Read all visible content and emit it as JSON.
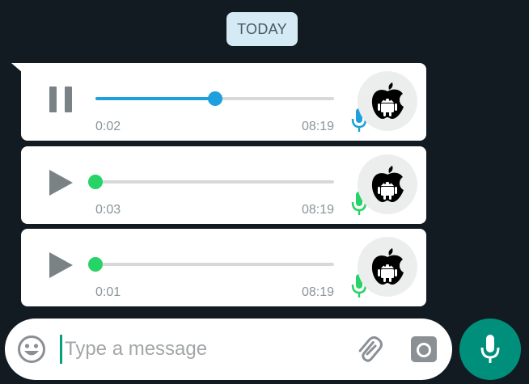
{
  "date_chip": "TODAY",
  "messages": [
    {
      "state": "playing",
      "control_icon": "pause-icon",
      "progress": 0.5,
      "duration": "0:02",
      "time": "08:19",
      "mic_color": "#1ea0dd",
      "knob_color": "#1ea0dd"
    },
    {
      "state": "paused",
      "control_icon": "play-icon",
      "progress": 0.0,
      "duration": "0:03",
      "time": "08:19",
      "mic_color": "#25d366",
      "knob_color": "#25d366"
    },
    {
      "state": "paused",
      "control_icon": "play-icon",
      "progress": 0.0,
      "duration": "0:01",
      "time": "08:19",
      "mic_color": "#25d366",
      "knob_color": "#25d366"
    }
  ],
  "avatar_icon": "apple-android-logo",
  "input": {
    "placeholder": "Type a message",
    "value": ""
  },
  "icons": {
    "emoji": "emoji-icon",
    "attach": "paperclip-icon",
    "camera": "camera-icon",
    "mic": "microphone-icon"
  },
  "colors": {
    "background": "#121b22",
    "accent_blue": "#1ea0dd",
    "accent_green": "#25d366",
    "fab": "#008f7a",
    "cursor": "#06a27b"
  }
}
